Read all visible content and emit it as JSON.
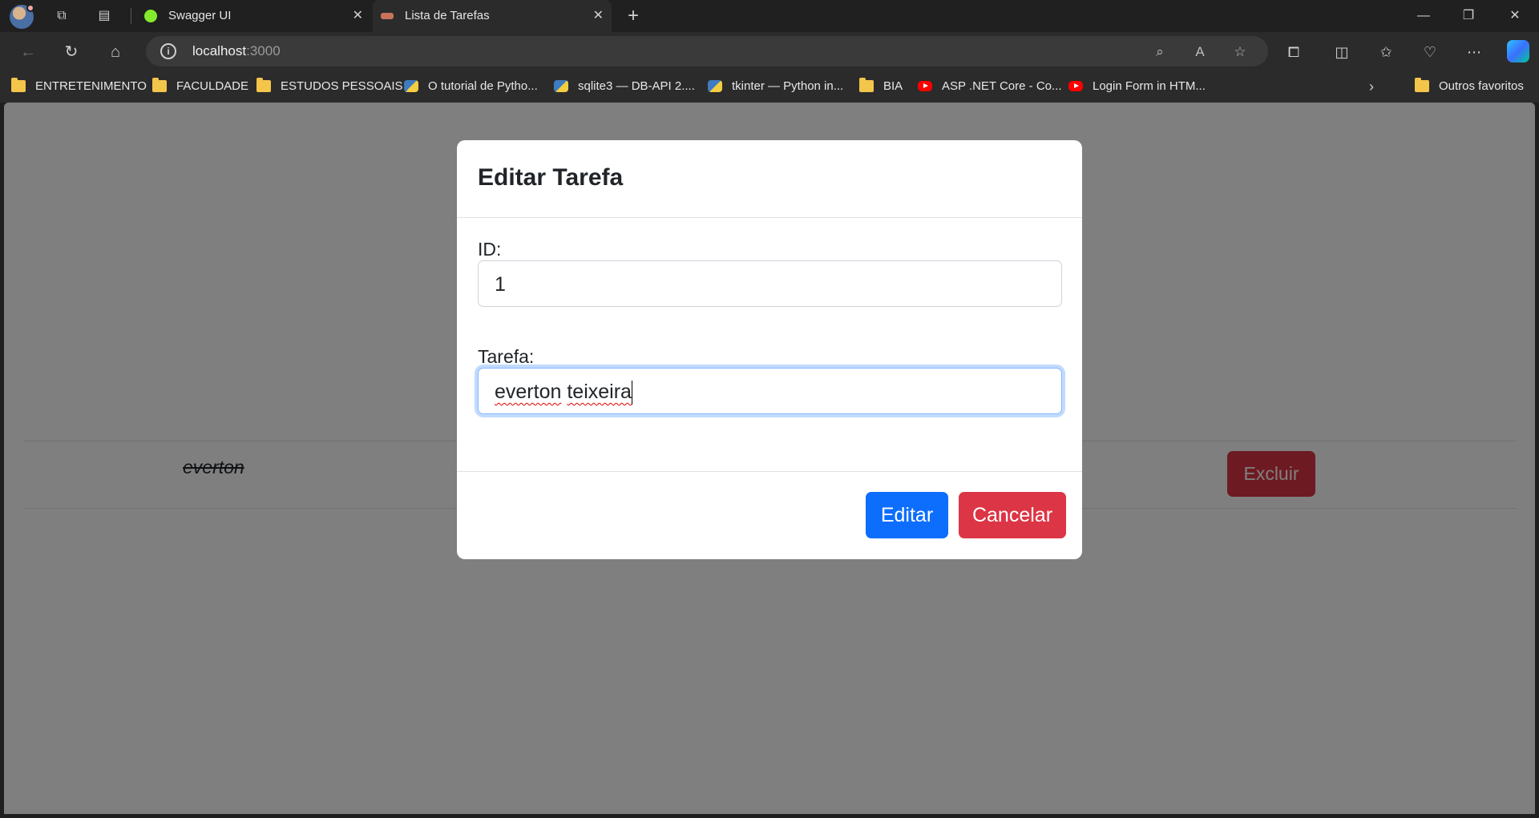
{
  "browser": {
    "tabs": [
      {
        "title": "Swagger UI",
        "favicon_color": "#85ea2d",
        "active": false
      },
      {
        "title": "Lista de Tarefas",
        "favicon_color": "#c8735a",
        "active": true
      }
    ],
    "address": {
      "host": "localhost",
      "port": ":3000"
    },
    "bookmarks": [
      {
        "label": "ENTRETENIMENTO",
        "icon": "folder-icon"
      },
      {
        "label": "FACULDADE",
        "icon": "folder-icon"
      },
      {
        "label": "ESTUDOS PESSOAIS",
        "icon": "folder-icon"
      },
      {
        "label": "O tutorial de Pytho...",
        "icon": "python-icon"
      },
      {
        "label": "sqlite3 — DB-API 2....",
        "icon": "python-icon"
      },
      {
        "label": "tkinter — Python in...",
        "icon": "python-icon"
      },
      {
        "label": "BIA",
        "icon": "folder-icon"
      },
      {
        "label": "ASP .NET Core - Co...",
        "icon": "youtube-icon"
      },
      {
        "label": "Login Form in HTM...",
        "icon": "youtube-icon"
      }
    ],
    "other_favorites": "Outros favoritos"
  },
  "page": {
    "task_item": {
      "text": "everton",
      "completed": true,
      "delete_label": "Excluir"
    }
  },
  "modal": {
    "title": "Editar Tarefa",
    "id_label": "ID:",
    "id_value": "1",
    "task_label": "Tarefa:",
    "task_value_word1": "everton",
    "task_value_word2": "teixeira",
    "submit_label": "Editar",
    "cancel_label": "Cancelar"
  },
  "colors": {
    "primary": "#0d6efd",
    "danger": "#dc3545",
    "backdrop": "rgba(0,0,0,0.5)"
  }
}
